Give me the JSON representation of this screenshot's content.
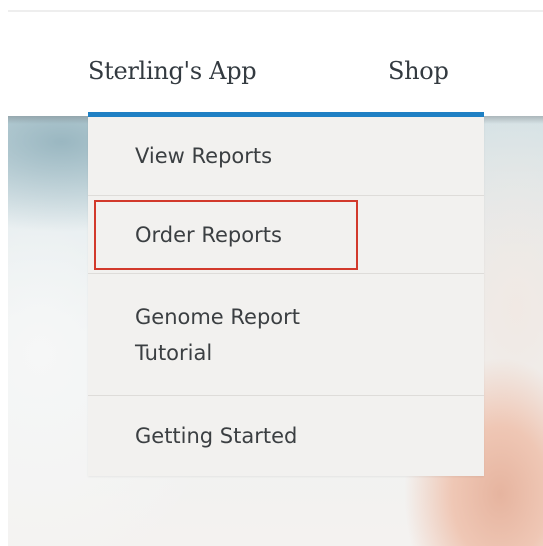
{
  "nav": {
    "app_label": "Sterling's App",
    "shop_label": "Shop",
    "accent_color": "#1f80c4"
  },
  "dropdown": {
    "items": [
      {
        "label": "View Reports"
      },
      {
        "label": "Order Reports",
        "highlighted": true
      },
      {
        "label": "Genome Report Tutorial"
      },
      {
        "label": "Getting Started"
      }
    ],
    "highlight_color": "#d2392b"
  }
}
